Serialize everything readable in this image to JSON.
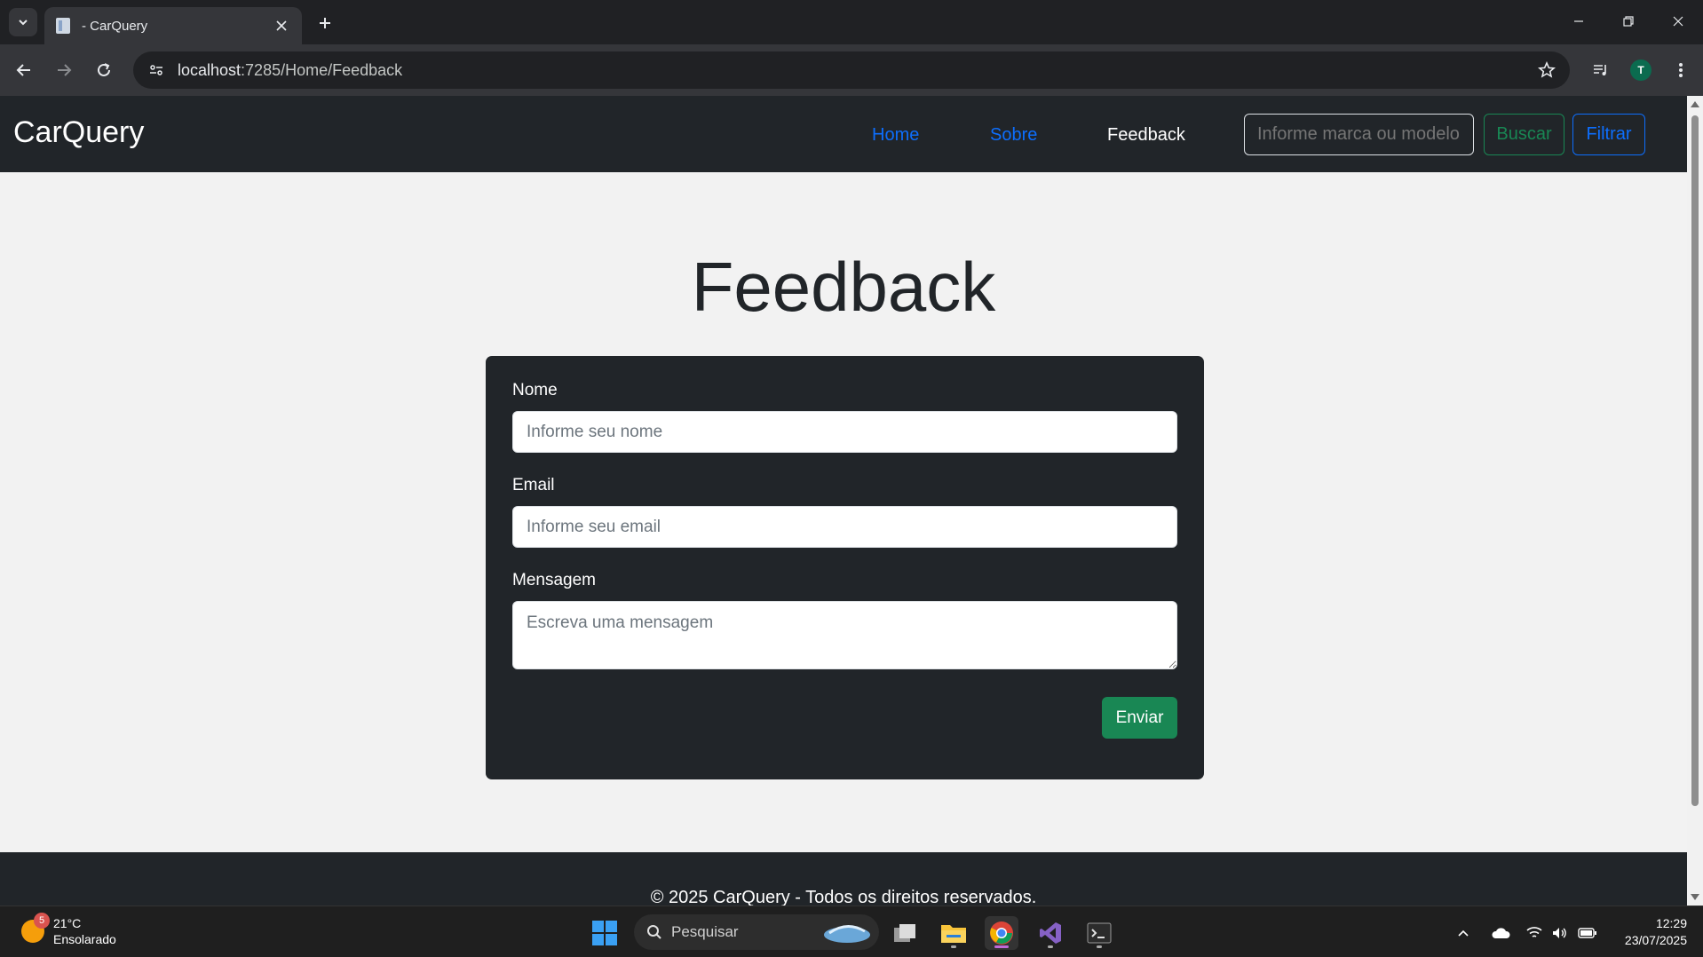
{
  "browser": {
    "tab_title": "- CarQuery",
    "url_host": "localhost",
    "url_rest": ":7285/Home/Feedback"
  },
  "site": {
    "brand": "CarQuery",
    "nav": [
      {
        "label": "Home"
      },
      {
        "label": "Sobre"
      },
      {
        "label": "Feedback"
      }
    ],
    "search_placeholder": "Informe marca ou modelo",
    "buscar_label": "Buscar",
    "filtrar_label": "Filtrar"
  },
  "page": {
    "title": "Feedback",
    "form": {
      "nome_label": "Nome",
      "nome_placeholder": "Informe seu nome",
      "email_label": "Email",
      "email_placeholder": "Informe seu email",
      "mensagem_label": "Mensagem",
      "mensagem_placeholder": "Escreva uma mensagem",
      "submit_label": "Enviar"
    }
  },
  "footer": {
    "text": "© 2025 CarQuery - Todos os direitos reservados."
  },
  "taskbar": {
    "weather_temp": "21°C",
    "weather_desc": "Ensolarado",
    "weather_badge": "5",
    "search_label": "Pesquisar",
    "time": "12:29",
    "date": "23/07/2025"
  },
  "profile_initial": "T",
  "colors": {
    "navbar_bg": "#212529",
    "page_bg": "#f2f2f2",
    "link_primary": "#0d6efd",
    "success": "#198754"
  }
}
